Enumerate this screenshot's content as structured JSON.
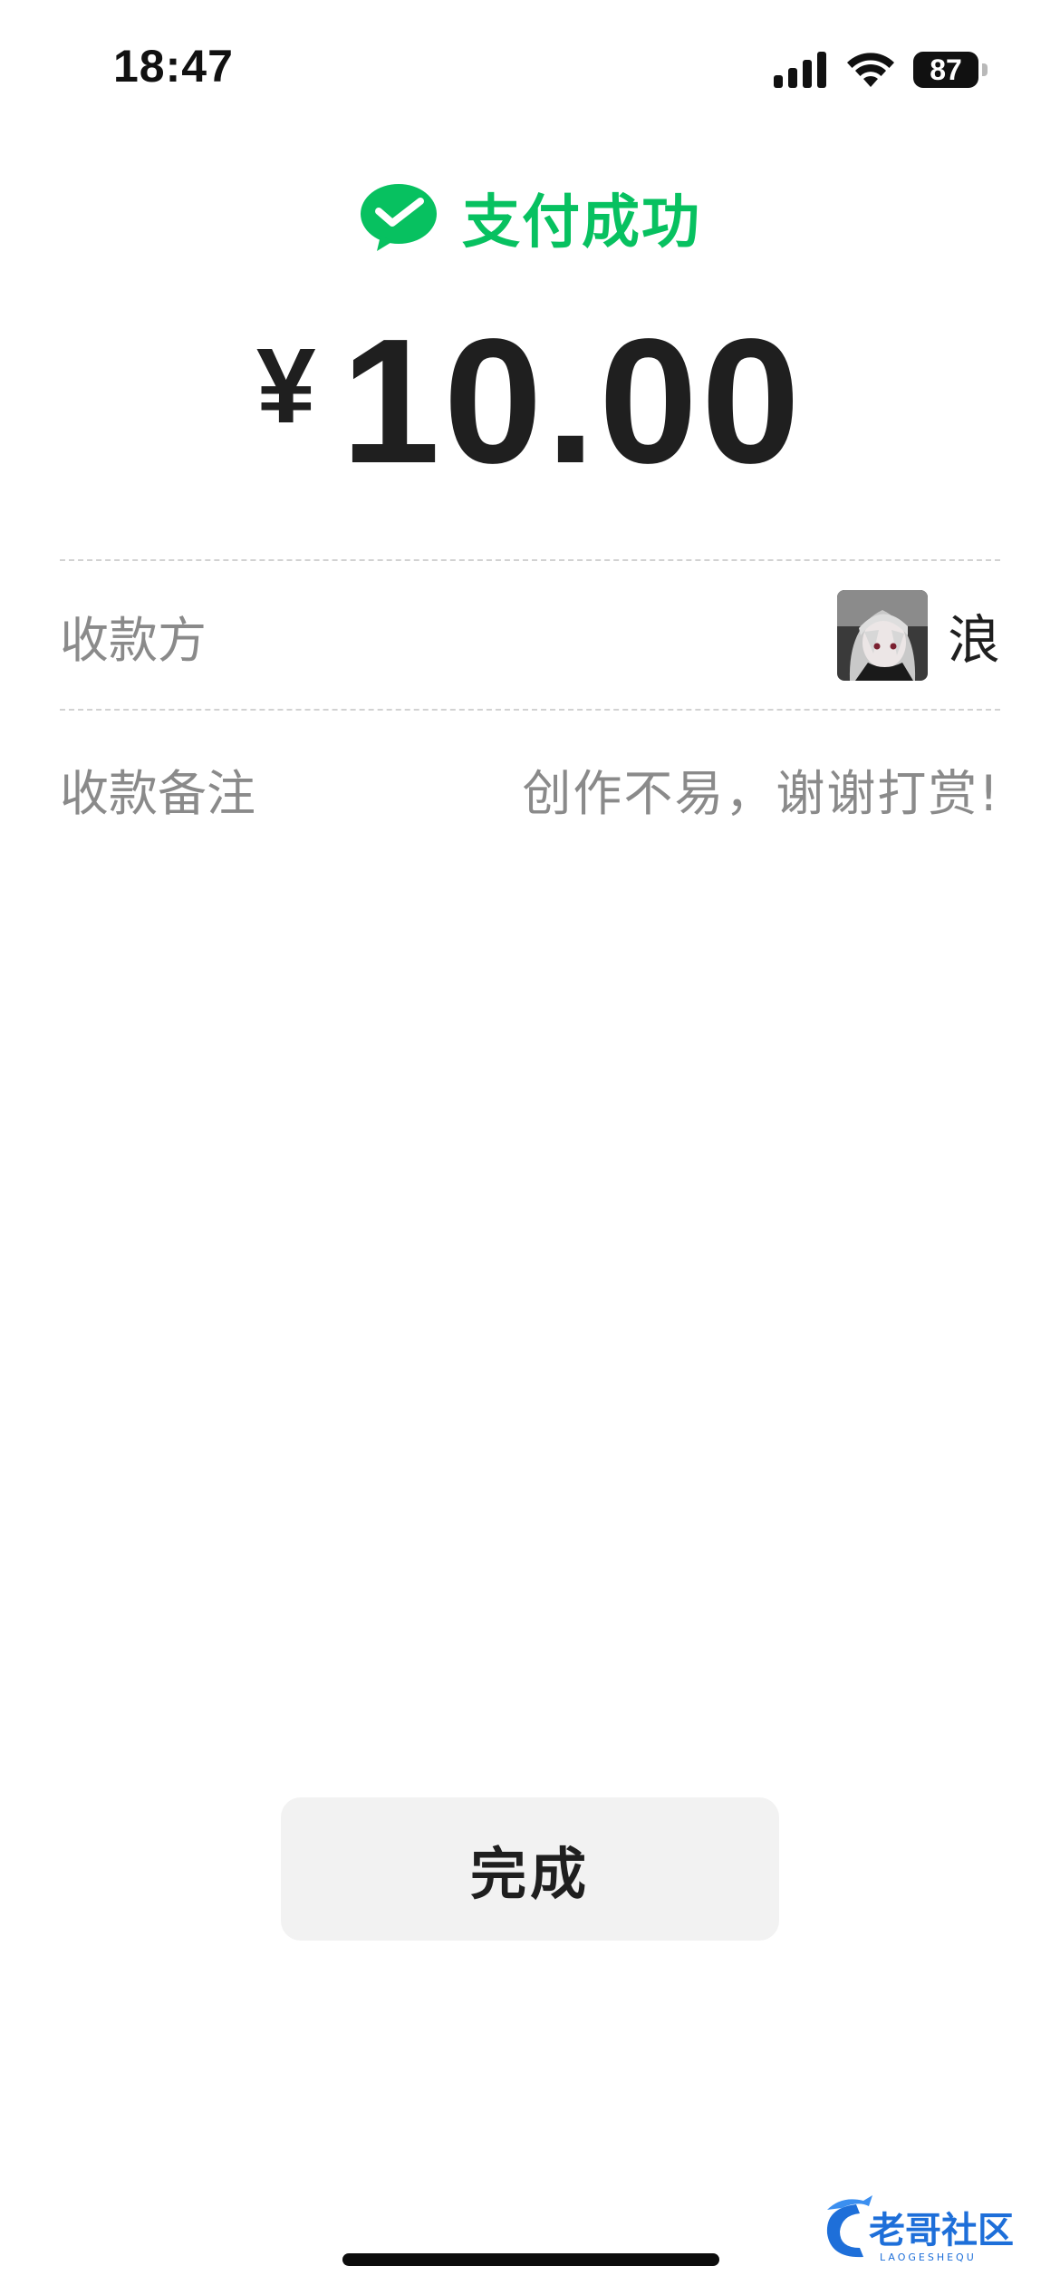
{
  "status_bar": {
    "time": "18:47",
    "battery": "87",
    "icons": [
      "signal-icon",
      "wifi-icon",
      "battery-icon"
    ]
  },
  "header": {
    "icon": "wechat-pay-check-icon",
    "title": "支付成功",
    "accent_color": "#07c160"
  },
  "payment": {
    "currency_symbol": "¥",
    "amount": "10.00"
  },
  "details": {
    "payee_label": "收款方",
    "payee_name": "浪",
    "payee_avatar": "avatar-image",
    "remark_label": "收款备注",
    "remark_value": "创作不易，谢谢打赏!"
  },
  "actions": {
    "done_label": "完成",
    "button_bg_color": "#f2f2f2"
  },
  "watermark": {
    "text": "老哥社区",
    "subtext": "LAOGESHEQU"
  }
}
